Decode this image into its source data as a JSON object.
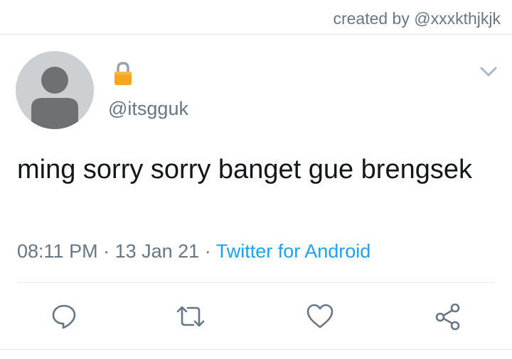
{
  "header": {
    "credit": "created by @xxxkthjkjk"
  },
  "tweet": {
    "lock_icon": "lock-icon",
    "handle": "@itsgguk",
    "text": "ming sorry sorry banget gue brengsek",
    "time": "08:11 PM",
    "date": "13 Jan 21",
    "separator": " · ",
    "source": "Twitter for Android"
  },
  "actions": {
    "reply_icon": "reply-icon",
    "retweet_icon": "retweet-icon",
    "like_icon": "heart-icon",
    "share_icon": "share-icon"
  },
  "colors": {
    "accent": "#1da1f2",
    "secondary_text": "#657786",
    "divider": "#e1e8ed",
    "lock_body": "#f5a623"
  }
}
